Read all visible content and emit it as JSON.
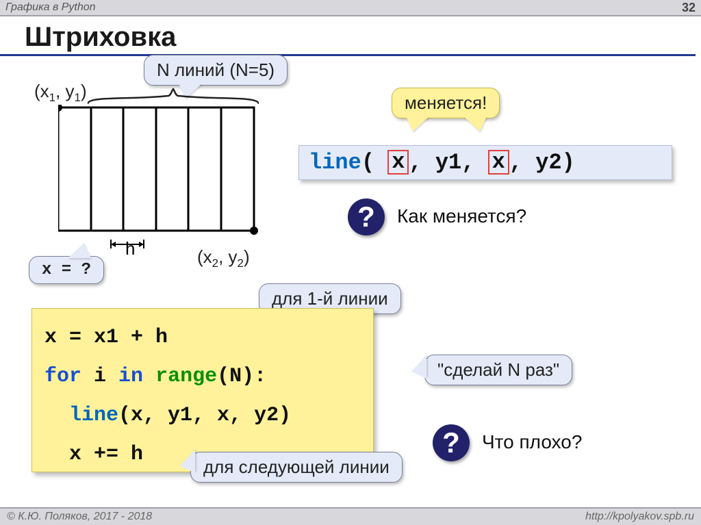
{
  "header": {
    "label": "Графика в Python",
    "page": "32"
  },
  "title": "Штриховка",
  "callouts": {
    "n_lines": "N линий (N=5)",
    "x_equals": "x = ?",
    "changes": "меняется!",
    "first_line": "для 1-й линии",
    "do_n_times": "\"сделай N раз\"",
    "next_line": "для следующей линии"
  },
  "coords": {
    "p1": "(x",
    "p1s": "1",
    "p1b": ", y",
    "p1s2": "1",
    "p1e": ")",
    "p2": "(x",
    "p2s": "2",
    "p2b": ", y",
    "p2s2": "2",
    "p2e": ")"
  },
  "h_label": "h",
  "codebar": {
    "fn": "line",
    "open": "( ",
    "x": "x",
    "c1": ", y1, ",
    "c2": ", y2)"
  },
  "questions": {
    "q_mark": "?",
    "how_changes": "Как меняется?",
    "whats_bad": "Что плохо?"
  },
  "codeblock": {
    "line1a": "x = x1 + h",
    "line2_for": "for",
    "line2_mid": " i ",
    "line2_in": "in",
    "line2_sp": " ",
    "line2_range": "range",
    "line2_end": "(N):",
    "line3_indent": "  ",
    "line3_fn": "line",
    "line3_args": "(x, y1, x, y2)",
    "line4": "  x += h"
  },
  "footer": {
    "left": "© К.Ю. Поляков, 2017 - 2018",
    "right": "http://kpolyakov.spb.ru"
  }
}
